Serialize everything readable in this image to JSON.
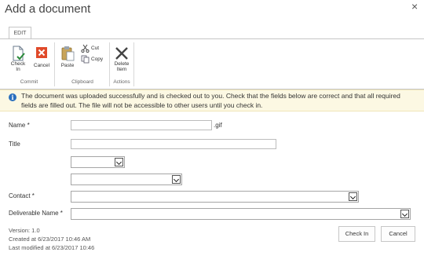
{
  "dialog": {
    "title": "Add a document",
    "close_glyph": "×"
  },
  "ribbon": {
    "tab": "EDIT",
    "groups": [
      {
        "label": "Commit",
        "buttons": [
          {
            "label": "Check In",
            "icon": "check-in-icon"
          },
          {
            "label": "Cancel",
            "icon": "cancel-icon"
          }
        ]
      },
      {
        "label": "Clipboard",
        "buttons": [
          {
            "label": "Paste",
            "icon": "paste-icon"
          },
          {
            "label": "Cut",
            "icon": "cut-icon"
          },
          {
            "label": "Copy",
            "icon": "copy-icon"
          }
        ]
      },
      {
        "label": "Actions",
        "buttons": [
          {
            "label": "Delete Item",
            "icon": "delete-icon"
          }
        ]
      }
    ]
  },
  "info": {
    "icon": "info-icon",
    "message": "The document was uploaded successfully and is checked out to you. Check that the fields below are correct and that all required fields are filled out. The file will not be accessible to other users until you check in."
  },
  "form": {
    "name_label": "Name *",
    "name_value": "",
    "name_suffix": ".gif",
    "title_label": "Title",
    "title_value": "",
    "contact_label": "Contact *",
    "deliverable_label": "Deliverable Name *"
  },
  "meta": {
    "version": "Version: 1.0",
    "created": "Created at 6/23/2017 10:46 AM",
    "modified": "Last modified at 6/23/2017 10:46"
  },
  "buttons": {
    "check_in": "Check In",
    "cancel": "Cancel"
  },
  "colors": {
    "info_bg": "#fcf8e3",
    "info_icon": "#2a6fbe",
    "cancel_icon": "#e04a2a"
  }
}
